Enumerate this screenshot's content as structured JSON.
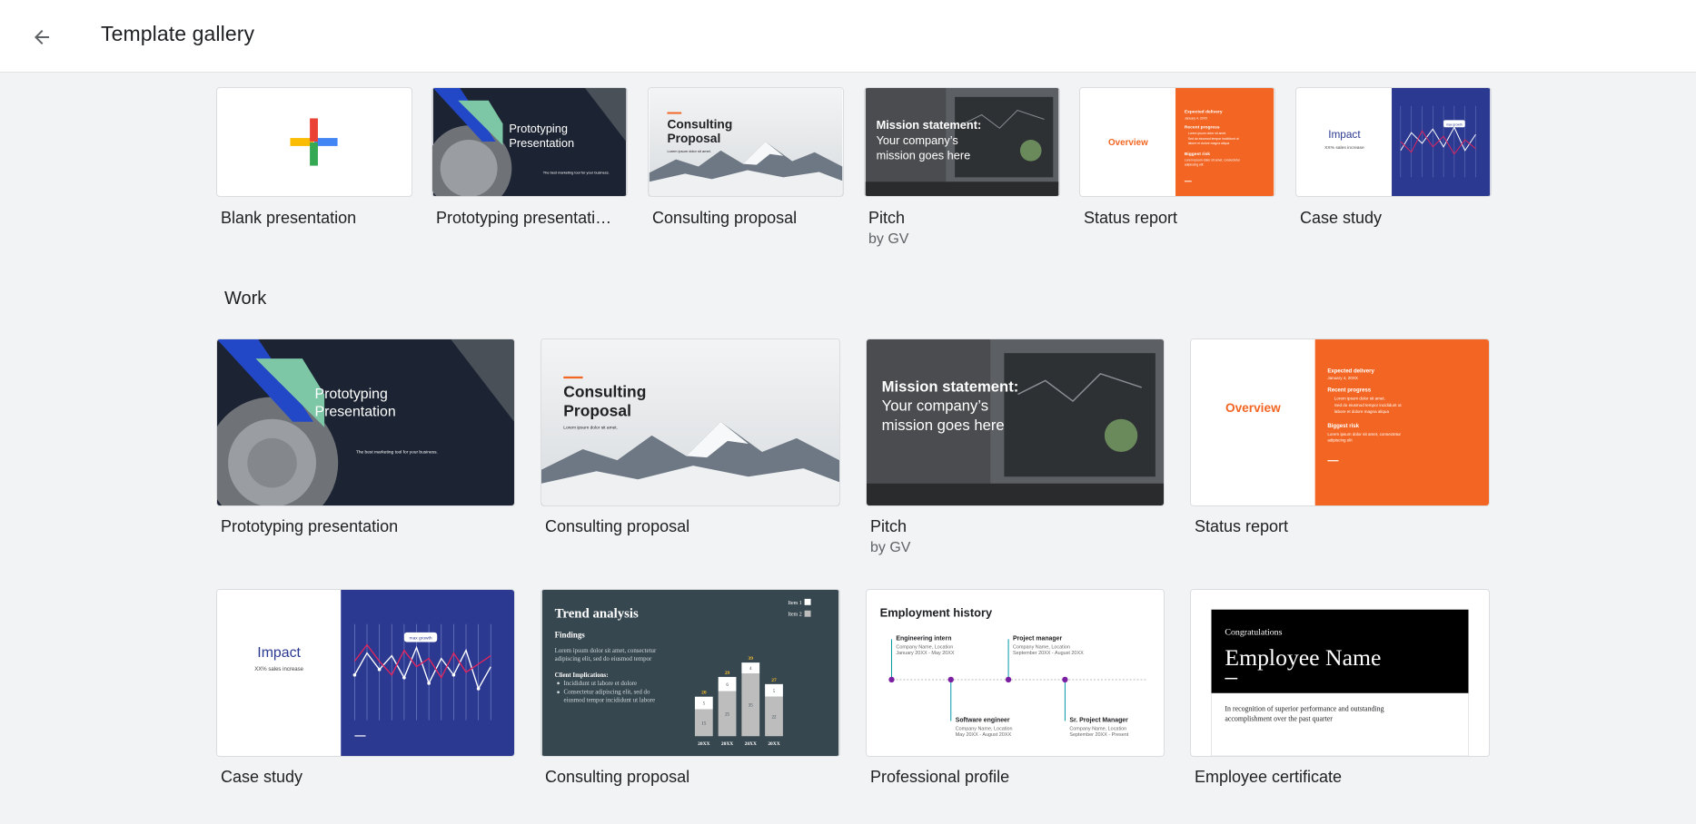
{
  "header": {
    "title": "Template gallery",
    "back_icon": "arrow-back-icon"
  },
  "recent": [
    {
      "title": "Blank presentation",
      "subtitle": "",
      "kind": "blank"
    },
    {
      "title": "Prototyping presentation",
      "display_title": "Prototyping presentati…",
      "subtitle": "",
      "kind": "prototyping"
    },
    {
      "title": "Consulting proposal",
      "subtitle": "",
      "kind": "consulting"
    },
    {
      "title": "Pitch",
      "subtitle": "by GV",
      "kind": "pitch"
    },
    {
      "title": "Status report",
      "subtitle": "",
      "kind": "status"
    },
    {
      "title": "Case study",
      "subtitle": "",
      "kind": "case"
    }
  ],
  "section": {
    "title": "Work"
  },
  "work": [
    {
      "title": "Prototyping presentation",
      "subtitle": "",
      "kind": "prototyping"
    },
    {
      "title": "Consulting proposal",
      "subtitle": "",
      "kind": "consulting"
    },
    {
      "title": "Pitch",
      "subtitle": "by GV",
      "kind": "pitch"
    },
    {
      "title": "Status report",
      "subtitle": "",
      "kind": "status"
    },
    {
      "title": "Case study",
      "subtitle": "",
      "kind": "case"
    },
    {
      "title": "Consulting proposal",
      "subtitle": "",
      "kind": "trend"
    },
    {
      "title": "Professional profile",
      "subtitle": "",
      "kind": "employment"
    },
    {
      "title": "Employee certificate",
      "subtitle": "",
      "kind": "certificate"
    }
  ],
  "thumbs": {
    "prototyping": {
      "line1": "Prototyping",
      "line2": "Presentation",
      "tagline": "The best marketing tool for your business."
    },
    "consulting": {
      "line1": "Consulting",
      "line2": "Proposal",
      "tagline": "Lorem ipsum dolor sit amet."
    },
    "pitch": {
      "line1": "Mission statement:",
      "line2": "Your company’s",
      "line3": "mission goes here"
    },
    "status": {
      "overview": "Overview",
      "delivery_label": "Expected delivery",
      "delivery_date": "January 4, 20XX",
      "progress_label": "Recent progress",
      "progress_1": "Lorem ipsum dolor sit amet.",
      "progress_2a": "Sed do eiusmod tempor incididunt ut",
      "progress_2b": "labore et dolore magna aliqua",
      "risk_label": "Biggest risk",
      "risk_a": "Lorem ipsum dolor sit amet, consectetur",
      "risk_b": "adipiscing elit"
    },
    "case": {
      "title": "Impact",
      "subtitle": "XX% sales increase",
      "callout": "max growth"
    },
    "trend": {
      "title": "Trend analysis",
      "findings": "Findings",
      "body_a": "Lorem ipsum dolor sit amet, consectetur",
      "body_b": "adipiscing elit, sed do eiusmod tempor",
      "impl": "Client Implications:",
      "b1": "Incididunt ut labore et dolore",
      "b2a": "Consectetur adipiscing elit, sed do",
      "b2b": "eiusmod tempor incididunt ut labore",
      "legend1": "Item 1",
      "legend2": "Item 2",
      "cats": [
        "20XX",
        "20XX",
        "20XX",
        "20XX"
      ],
      "top": [
        20,
        29,
        39,
        27
      ],
      "item2": [
        5,
        6,
        4,
        5
      ],
      "item1": [
        15,
        25,
        35,
        22
      ]
    },
    "employment": {
      "title": "Employment history",
      "jobs": [
        {
          "role": "Engineering intern",
          "place": "Company Name, Location",
          "dates": "January 20XX - May 20XX"
        },
        {
          "role": "Software engineer",
          "place": "Company Name, Location",
          "dates": "May 20XX - August 20XX"
        },
        {
          "role": "Project manager",
          "place": "Company Name, Location",
          "dates": "September 20XX - August 20XX"
        },
        {
          "role": "Sr. Project Manager",
          "place": "Company Name, Location",
          "dates": "September 20XX - Present"
        }
      ]
    },
    "certificate": {
      "congrats": "Congratulations",
      "name": "Employee Name",
      "body_a": "In recognition of superior performance and outstanding",
      "body_b": "accomplishment over the past quarter"
    }
  },
  "colors": {
    "header_bg": "#ffffff",
    "page_bg": "#f1f3f4",
    "orange": "#f26522",
    "navy": "#2b3990",
    "dark": "#1c2433",
    "teal": "#7dc7a6",
    "slate": "#37474f"
  }
}
